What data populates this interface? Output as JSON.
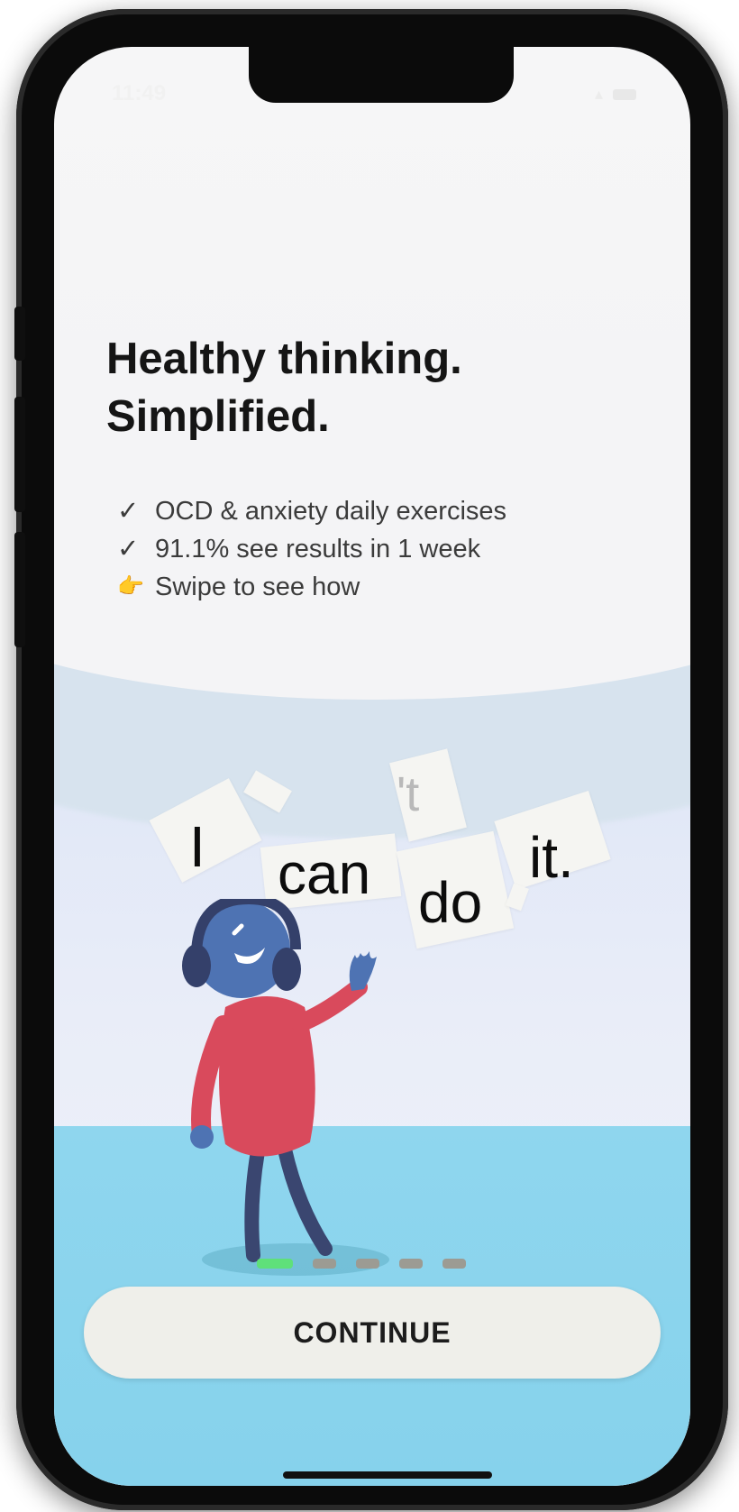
{
  "status_bar": {
    "time": "11:49"
  },
  "headline": {
    "line1": "Healthy thinking.",
    "line2": "Simplified."
  },
  "bullets": [
    {
      "icon": "check-icon",
      "glyph": "✓",
      "text": "OCD & anxiety daily exercises"
    },
    {
      "icon": "check-icon",
      "glyph": "✓",
      "text": "91.1% see results in 1 week"
    },
    {
      "icon": "pointing-hand-icon",
      "glyph": "👉",
      "text": "Swipe to see how"
    }
  ],
  "illustration": {
    "words": [
      "I",
      "can",
      "'t",
      "do",
      "it."
    ]
  },
  "pagination": {
    "total": 5,
    "active_index": 0
  },
  "continue_button": {
    "label": "CONTINUE"
  },
  "colors": {
    "accent_green": "#5fe07a",
    "floor_blue": "#8fd6ee",
    "shirt_red": "#d94a5c",
    "figure_blue": "#4e73b3"
  }
}
